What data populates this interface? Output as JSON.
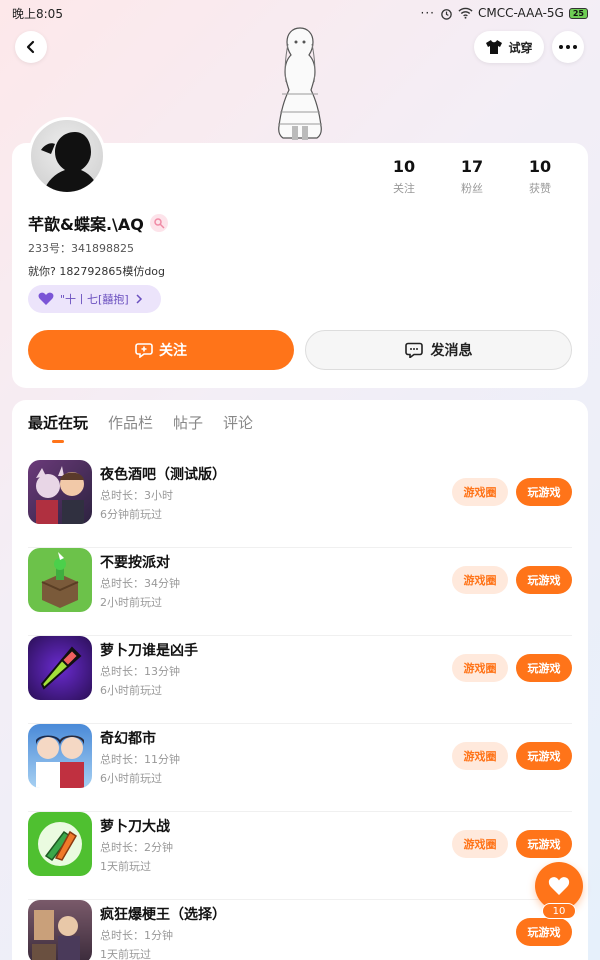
{
  "status_bar": {
    "time": "晚上8:05",
    "carrier": "CMCC-AAA-5G",
    "battery": "25"
  },
  "header": {
    "tryon_label": "试穿"
  },
  "profile": {
    "stats": [
      {
        "num": "10",
        "label": "关注"
      },
      {
        "num": "17",
        "label": "粉丝"
      },
      {
        "num": "10",
        "label": "获赞"
      }
    ],
    "username": "芊歆&蝶案.\\AQ",
    "uid": "233号：341898825",
    "bio": "就你? 182792865模仿dog",
    "tag": "\"十丨七[囍抱]",
    "follow_label": "关注",
    "message_label": "发消息"
  },
  "tabs": [
    "最近在玩",
    "作品栏",
    "帖子",
    "评论"
  ],
  "game_buttons": {
    "circle": "游戏圈",
    "play": "玩游戏"
  },
  "games": [
    {
      "name": "夜色酒吧（测试版）",
      "duration": "总时长：3小时",
      "last": "6分钟前玩过"
    },
    {
      "name": "不要按派对",
      "duration": "总时长：34分钟",
      "last": "2小时前玩过"
    },
    {
      "name": "萝卜刀谁是凶手",
      "duration": "总时长：13分钟",
      "last": "6小时前玩过"
    },
    {
      "name": "奇幻都市",
      "duration": "总时长：11分钟",
      "last": "6小时前玩过"
    },
    {
      "name": "萝卜刀大战",
      "duration": "总时长：2分钟",
      "last": "1天前玩过"
    },
    {
      "name": "疯狂爆梗王（选择）",
      "duration": "总时长：1分钟",
      "last": "1天前玩过"
    }
  ],
  "like_count": "10",
  "colors": {
    "accent": "#ff7419",
    "tag_bg": "#ece4fb"
  }
}
